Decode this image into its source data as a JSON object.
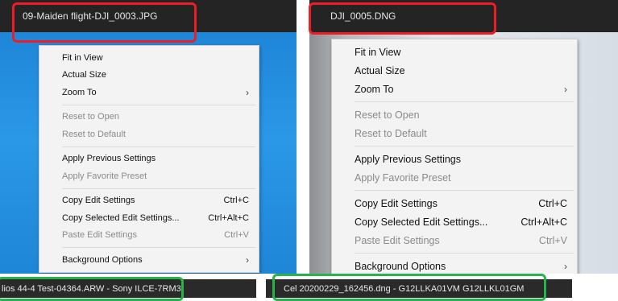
{
  "left_panel": {
    "filename": "09-Maiden flight-DJI_0003.JPG",
    "context_menu": {
      "groups": [
        [
          {
            "label": "Fit in View",
            "enabled": true
          },
          {
            "label": "Actual Size",
            "enabled": true
          },
          {
            "label": "Zoom To",
            "enabled": true,
            "submenu": "›"
          }
        ],
        [
          {
            "label": "Reset to Open",
            "enabled": false
          },
          {
            "label": "Reset to Default",
            "enabled": false
          }
        ],
        [
          {
            "label": "Apply Previous Settings",
            "enabled": true
          },
          {
            "label": "Apply Favorite Preset",
            "enabled": false
          }
        ],
        [
          {
            "label": "Copy Edit Settings",
            "shortcut": "Ctrl+C",
            "enabled": true
          },
          {
            "label": "Copy Selected Edit Settings...",
            "shortcut": "Ctrl+Alt+C",
            "enabled": true
          },
          {
            "label": "Paste Edit Settings",
            "shortcut": "Ctrl+V",
            "enabled": false
          }
        ],
        [
          {
            "label": "Background Options",
            "enabled": true,
            "submenu": "›"
          }
        ]
      ]
    },
    "status_text": "lios 44-4 Test-04364.ARW  -  Sony ILCE-7RM3"
  },
  "right_panel": {
    "filename": "DJI_0005.DNG",
    "context_menu": {
      "groups": [
        [
          {
            "label": "Fit in View",
            "enabled": true
          },
          {
            "label": "Actual Size",
            "enabled": true
          },
          {
            "label": "Zoom To",
            "enabled": true,
            "submenu": "›"
          }
        ],
        [
          {
            "label": "Reset to Open",
            "enabled": false
          },
          {
            "label": "Reset to Default",
            "enabled": false
          }
        ],
        [
          {
            "label": "Apply Previous Settings",
            "enabled": true
          },
          {
            "label": "Apply Favorite Preset",
            "enabled": false
          }
        ],
        [
          {
            "label": "Copy Edit Settings",
            "shortcut": "Ctrl+C",
            "enabled": true
          },
          {
            "label": "Copy Selected Edit Settings...",
            "shortcut": "Ctrl+Alt+C",
            "enabled": true
          },
          {
            "label": "Paste Edit Settings",
            "shortcut": "Ctrl+V",
            "enabled": false
          }
        ],
        [
          {
            "label": "Background Options",
            "enabled": true,
            "submenu": "›"
          }
        ]
      ]
    },
    "status_text": "Cel 20200229_162456.dng  -  G12LLKA01VM G12LLKL01GM"
  },
  "colors": {
    "highlight_red": "#ee1c24",
    "highlight_green": "#25b34a"
  }
}
